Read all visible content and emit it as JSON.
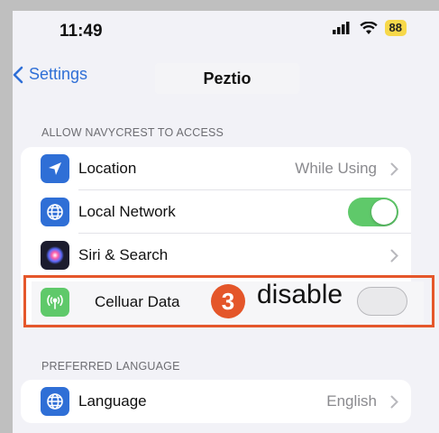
{
  "status_bar": {
    "time": "11:49",
    "battery": "88"
  },
  "nav": {
    "back_label": "Settings",
    "title": "Peztio"
  },
  "sections": [
    {
      "header": "ALLOW NAVYCREST TO ACCESS",
      "rows": [
        {
          "label": "Location",
          "value": "While Using",
          "icon": "location-arrow-icon",
          "icon_color": "#2f6fd6"
        },
        {
          "label": "Local Network",
          "toggle": true,
          "icon": "globe-icon",
          "icon_color": "#2f6fd6"
        },
        {
          "label": "Siri & Search",
          "icon": "siri-icon",
          "icon_color": "#1c1c2e"
        },
        {
          "label": "Celluar Data",
          "toggle": false,
          "icon": "antenna-icon",
          "icon_color": "#5fc96a"
        }
      ]
    },
    {
      "header": "PREFERRED LANGUAGE",
      "rows": [
        {
          "label": "Language",
          "value": "English",
          "icon": "globe-icon",
          "icon_color": "#2f6fd6"
        }
      ]
    }
  ],
  "annotation": {
    "step": "3",
    "text": "disable",
    "color": "#e5572b"
  },
  "colors": {
    "toggle_on": "#5fc96a",
    "toggle_off": "#e9e9eb",
    "accent": "#2f6fd6"
  }
}
